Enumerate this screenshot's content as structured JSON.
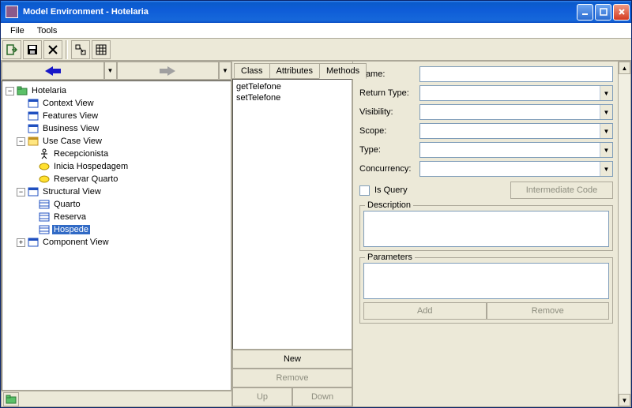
{
  "title": "Model Environment - Hotelaria",
  "menu": {
    "file": "File",
    "tools": "Tools"
  },
  "tree": {
    "root": "Hotelaria",
    "context": "Context View",
    "features": "Features View",
    "business": "Business View",
    "usecase": "Use Case View",
    "recepcionista": "Recepcionista",
    "inicia": "Inicia Hospedagem",
    "reservar": "Reservar Quarto",
    "structural": "Structural View",
    "quarto": "Quarto",
    "reserva": "Reserva",
    "hospede": "Hospede",
    "component": "Component View"
  },
  "tabs": {
    "class": "Class",
    "attributes": "Attributes",
    "methods": "Methods"
  },
  "methods": {
    "get": "getTelefone",
    "set": "setTelefone"
  },
  "buttons": {
    "new": "New",
    "remove": "Remove",
    "up": "Up",
    "down": "Down",
    "add": "Add",
    "intermediate": "Intermediate Code"
  },
  "form": {
    "name": "Name:",
    "returnType": "Return Type:",
    "visibility": "Visibility:",
    "scope": "Scope:",
    "type": "Type:",
    "concurrency": "Concurrency:",
    "isQuery": "Is Query",
    "description": "Description",
    "parameters": "Parameters"
  }
}
